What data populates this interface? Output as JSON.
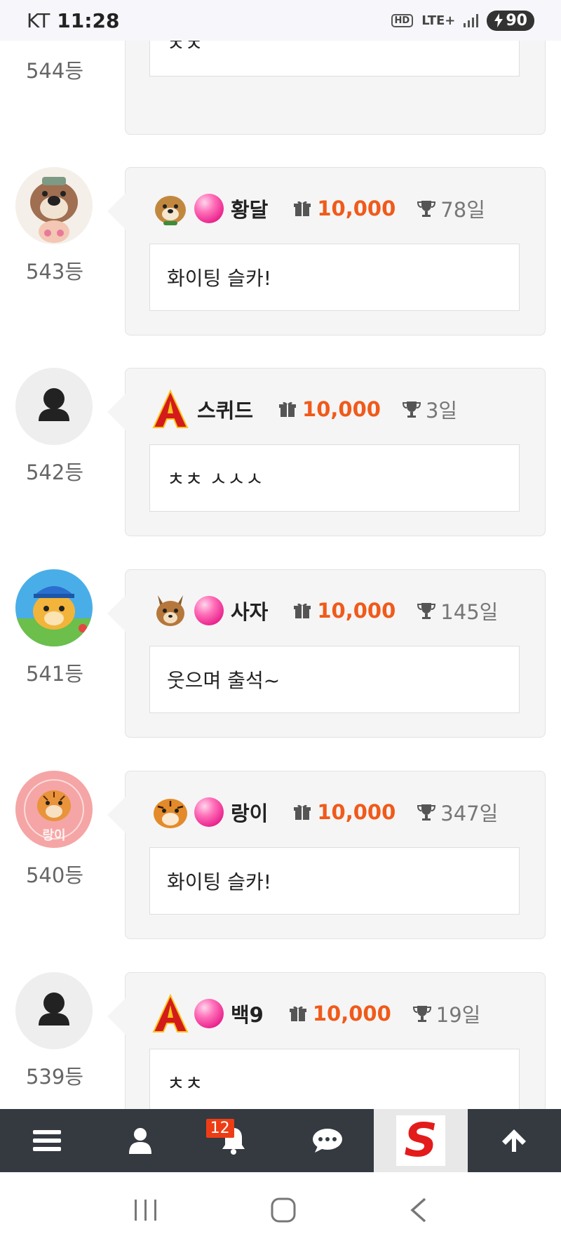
{
  "status_bar": {
    "carrier": "KT",
    "time": "11:28",
    "hd_label": "HD",
    "lte_label": "LTE+",
    "battery": "90"
  },
  "entries": [
    {
      "rank": "544등",
      "nickname": "",
      "points": "",
      "days": "",
      "message": "ㅊㅊ",
      "avatar": "partial",
      "has_header": false
    },
    {
      "rank": "543등",
      "nickname": "황달",
      "points": "10,000",
      "days": "78일",
      "message": "화이팅 슬카!",
      "avatar": "otter",
      "badge": "dog",
      "has_gem": true,
      "has_header": true
    },
    {
      "rank": "542등",
      "nickname": "스퀴드",
      "points": "10,000",
      "days": "3일",
      "message": "ㅊㅊ ㅅㅅㅅ",
      "avatar": "default-user",
      "badge": "letter-a",
      "has_gem": false,
      "has_header": true
    },
    {
      "rank": "541등",
      "nickname": "사자",
      "points": "10,000",
      "days": "145일",
      "message": "웃으며 출석~",
      "avatar": "lion-cub",
      "badge": "squirrel",
      "has_gem": true,
      "has_header": true
    },
    {
      "rank": "540등",
      "nickname": "랑이",
      "points": "10,000",
      "days": "347일",
      "message": "화이팅 슬카!",
      "avatar": "tiger-cub",
      "avatar_text": "랑이",
      "badge": "tiger",
      "has_gem": true,
      "has_header": true
    },
    {
      "rank": "539등",
      "nickname": "백9",
      "points": "10,000",
      "days": "19일",
      "message": "ㅊㅊ",
      "avatar": "default-user",
      "badge": "letter-a",
      "has_gem": true,
      "has_header": true
    }
  ],
  "bottom_nav": {
    "items": [
      "menu-icon",
      "user-icon",
      "bell-icon",
      "chat-icon",
      "logo",
      "arrow-up-icon"
    ],
    "notification_count": "12",
    "logo_letter": "S"
  },
  "colors": {
    "points": "#f05a1a",
    "nav_bg": "#343a40",
    "card_bg": "#f5f5f5",
    "badge": "#ee3d16"
  }
}
